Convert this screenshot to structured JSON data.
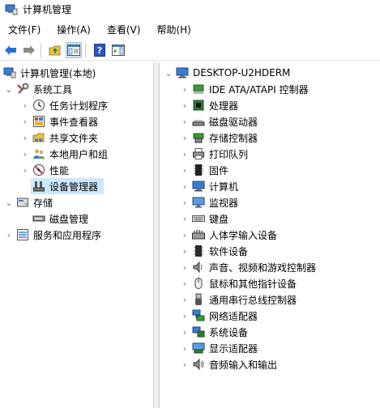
{
  "window": {
    "title": "计算机管理"
  },
  "menu": [
    {
      "label": "文件(F)"
    },
    {
      "label": "操作(A)"
    },
    {
      "label": "查看(V)"
    },
    {
      "label": "帮助(H)"
    }
  ],
  "toolbar": {
    "buttons": [
      "back-icon",
      "forward-icon",
      "up-folder-icon",
      "show-hide-console-tree-icon",
      "help-icon",
      "action-pane-icon"
    ]
  },
  "tree": {
    "root": {
      "label": "计算机管理(本地)"
    },
    "system_tools": {
      "label": "系统工具",
      "children": [
        {
          "label": "任务计划程序",
          "icon": "clock-icon"
        },
        {
          "label": "事件查看器",
          "icon": "event-viewer-icon"
        },
        {
          "label": "共享文件夹",
          "icon": "shared-folder-icon"
        },
        {
          "label": "本地用户和组",
          "icon": "users-icon"
        },
        {
          "label": "性能",
          "icon": "performance-icon"
        },
        {
          "label": "设备管理器",
          "icon": "device-manager-icon",
          "selected": true
        }
      ]
    },
    "storage": {
      "label": "存储",
      "children": [
        {
          "label": "磁盘管理",
          "icon": "disk-management-icon"
        }
      ]
    },
    "services": {
      "label": "服务和应用程序"
    }
  },
  "devices": {
    "computer_name": "DESKTOP-U2HDERM",
    "categories": [
      {
        "label": "IDE ATA/ATAPI 控制器",
        "icon": "ide-controller-icon"
      },
      {
        "label": "处理器",
        "icon": "processor-icon"
      },
      {
        "label": "磁盘驱动器",
        "icon": "disk-drive-icon"
      },
      {
        "label": "存储控制器",
        "icon": "storage-controller-icon"
      },
      {
        "label": "打印队列",
        "icon": "printer-icon"
      },
      {
        "label": "固件",
        "icon": "firmware-icon"
      },
      {
        "label": "计算机",
        "icon": "computer-icon"
      },
      {
        "label": "监视器",
        "icon": "monitor-icon"
      },
      {
        "label": "键盘",
        "icon": "keyboard-icon"
      },
      {
        "label": "人体学输入设备",
        "icon": "hid-icon"
      },
      {
        "label": "软件设备",
        "icon": "software-device-icon"
      },
      {
        "label": "声音、视频和游戏控制器",
        "icon": "speaker-icon"
      },
      {
        "label": "鼠标和其他指针设备",
        "icon": "mouse-icon"
      },
      {
        "label": "通用串行总线控制器",
        "icon": "usb-icon"
      },
      {
        "label": "网络适配器",
        "icon": "network-adapter-icon"
      },
      {
        "label": "系统设备",
        "icon": "system-device-icon"
      },
      {
        "label": "显示适配器",
        "icon": "display-adapter-icon"
      },
      {
        "label": "音频输入和输出",
        "icon": "audio-io-icon"
      }
    ]
  },
  "colors": {
    "selection": "#cce8ff",
    "accent": "#0078d7"
  }
}
